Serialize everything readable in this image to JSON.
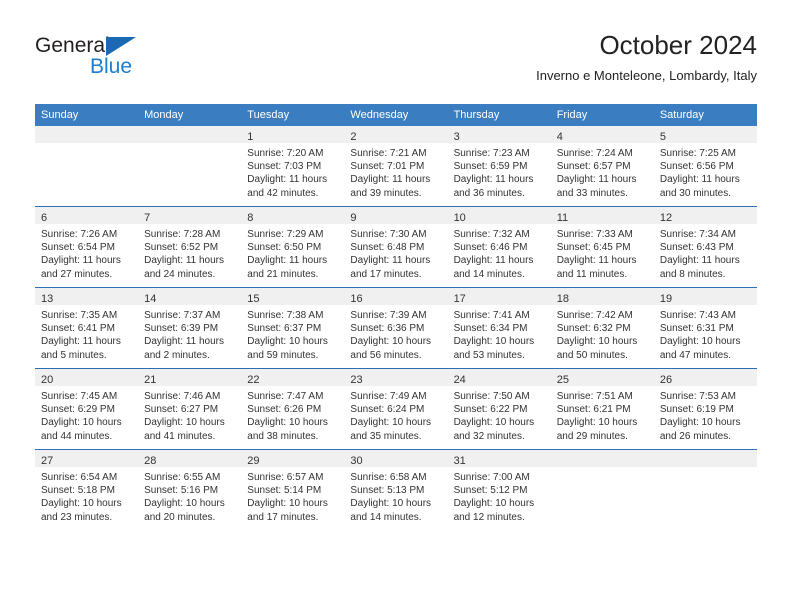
{
  "brand": {
    "name_top": "General",
    "name_bottom": "Blue",
    "accent_color": "#1b7fd1",
    "triangle_color": "#1b69b2"
  },
  "header": {
    "title": "October 2024",
    "subtitle": "Inverno e Monteleone, Lombardy, Italy"
  },
  "calendar": {
    "header_bg": "#3a7ec1",
    "row_border_color": "#2a6eb5",
    "daynum_band_bg": "#f0f0f0",
    "weekday_headers": [
      "Sunday",
      "Monday",
      "Tuesday",
      "Wednesday",
      "Thursday",
      "Friday",
      "Saturday"
    ],
    "weeks": [
      [
        {
          "day": "",
          "sunrise": "",
          "sunset": "",
          "daylight": ""
        },
        {
          "day": "",
          "sunrise": "",
          "sunset": "",
          "daylight": ""
        },
        {
          "day": "1",
          "sunrise": "Sunrise: 7:20 AM",
          "sunset": "Sunset: 7:03 PM",
          "daylight": "Daylight: 11 hours and 42 minutes."
        },
        {
          "day": "2",
          "sunrise": "Sunrise: 7:21 AM",
          "sunset": "Sunset: 7:01 PM",
          "daylight": "Daylight: 11 hours and 39 minutes."
        },
        {
          "day": "3",
          "sunrise": "Sunrise: 7:23 AM",
          "sunset": "Sunset: 6:59 PM",
          "daylight": "Daylight: 11 hours and 36 minutes."
        },
        {
          "day": "4",
          "sunrise": "Sunrise: 7:24 AM",
          "sunset": "Sunset: 6:57 PM",
          "daylight": "Daylight: 11 hours and 33 minutes."
        },
        {
          "day": "5",
          "sunrise": "Sunrise: 7:25 AM",
          "sunset": "Sunset: 6:56 PM",
          "daylight": "Daylight: 11 hours and 30 minutes."
        }
      ],
      [
        {
          "day": "6",
          "sunrise": "Sunrise: 7:26 AM",
          "sunset": "Sunset: 6:54 PM",
          "daylight": "Daylight: 11 hours and 27 minutes."
        },
        {
          "day": "7",
          "sunrise": "Sunrise: 7:28 AM",
          "sunset": "Sunset: 6:52 PM",
          "daylight": "Daylight: 11 hours and 24 minutes."
        },
        {
          "day": "8",
          "sunrise": "Sunrise: 7:29 AM",
          "sunset": "Sunset: 6:50 PM",
          "daylight": "Daylight: 11 hours and 21 minutes."
        },
        {
          "day": "9",
          "sunrise": "Sunrise: 7:30 AM",
          "sunset": "Sunset: 6:48 PM",
          "daylight": "Daylight: 11 hours and 17 minutes."
        },
        {
          "day": "10",
          "sunrise": "Sunrise: 7:32 AM",
          "sunset": "Sunset: 6:46 PM",
          "daylight": "Daylight: 11 hours and 14 minutes."
        },
        {
          "day": "11",
          "sunrise": "Sunrise: 7:33 AM",
          "sunset": "Sunset: 6:45 PM",
          "daylight": "Daylight: 11 hours and 11 minutes."
        },
        {
          "day": "12",
          "sunrise": "Sunrise: 7:34 AM",
          "sunset": "Sunset: 6:43 PM",
          "daylight": "Daylight: 11 hours and 8 minutes."
        }
      ],
      [
        {
          "day": "13",
          "sunrise": "Sunrise: 7:35 AM",
          "sunset": "Sunset: 6:41 PM",
          "daylight": "Daylight: 11 hours and 5 minutes."
        },
        {
          "day": "14",
          "sunrise": "Sunrise: 7:37 AM",
          "sunset": "Sunset: 6:39 PM",
          "daylight": "Daylight: 11 hours and 2 minutes."
        },
        {
          "day": "15",
          "sunrise": "Sunrise: 7:38 AM",
          "sunset": "Sunset: 6:37 PM",
          "daylight": "Daylight: 10 hours and 59 minutes."
        },
        {
          "day": "16",
          "sunrise": "Sunrise: 7:39 AM",
          "sunset": "Sunset: 6:36 PM",
          "daylight": "Daylight: 10 hours and 56 minutes."
        },
        {
          "day": "17",
          "sunrise": "Sunrise: 7:41 AM",
          "sunset": "Sunset: 6:34 PM",
          "daylight": "Daylight: 10 hours and 53 minutes."
        },
        {
          "day": "18",
          "sunrise": "Sunrise: 7:42 AM",
          "sunset": "Sunset: 6:32 PM",
          "daylight": "Daylight: 10 hours and 50 minutes."
        },
        {
          "day": "19",
          "sunrise": "Sunrise: 7:43 AM",
          "sunset": "Sunset: 6:31 PM",
          "daylight": "Daylight: 10 hours and 47 minutes."
        }
      ],
      [
        {
          "day": "20",
          "sunrise": "Sunrise: 7:45 AM",
          "sunset": "Sunset: 6:29 PM",
          "daylight": "Daylight: 10 hours and 44 minutes."
        },
        {
          "day": "21",
          "sunrise": "Sunrise: 7:46 AM",
          "sunset": "Sunset: 6:27 PM",
          "daylight": "Daylight: 10 hours and 41 minutes."
        },
        {
          "day": "22",
          "sunrise": "Sunrise: 7:47 AM",
          "sunset": "Sunset: 6:26 PM",
          "daylight": "Daylight: 10 hours and 38 minutes."
        },
        {
          "day": "23",
          "sunrise": "Sunrise: 7:49 AM",
          "sunset": "Sunset: 6:24 PM",
          "daylight": "Daylight: 10 hours and 35 minutes."
        },
        {
          "day": "24",
          "sunrise": "Sunrise: 7:50 AM",
          "sunset": "Sunset: 6:22 PM",
          "daylight": "Daylight: 10 hours and 32 minutes."
        },
        {
          "day": "25",
          "sunrise": "Sunrise: 7:51 AM",
          "sunset": "Sunset: 6:21 PM",
          "daylight": "Daylight: 10 hours and 29 minutes."
        },
        {
          "day": "26",
          "sunrise": "Sunrise: 7:53 AM",
          "sunset": "Sunset: 6:19 PM",
          "daylight": "Daylight: 10 hours and 26 minutes."
        }
      ],
      [
        {
          "day": "27",
          "sunrise": "Sunrise: 6:54 AM",
          "sunset": "Sunset: 5:18 PM",
          "daylight": "Daylight: 10 hours and 23 minutes."
        },
        {
          "day": "28",
          "sunrise": "Sunrise: 6:55 AM",
          "sunset": "Sunset: 5:16 PM",
          "daylight": "Daylight: 10 hours and 20 minutes."
        },
        {
          "day": "29",
          "sunrise": "Sunrise: 6:57 AM",
          "sunset": "Sunset: 5:14 PM",
          "daylight": "Daylight: 10 hours and 17 minutes."
        },
        {
          "day": "30",
          "sunrise": "Sunrise: 6:58 AM",
          "sunset": "Sunset: 5:13 PM",
          "daylight": "Daylight: 10 hours and 14 minutes."
        },
        {
          "day": "31",
          "sunrise": "Sunrise: 7:00 AM",
          "sunset": "Sunset: 5:12 PM",
          "daylight": "Daylight: 10 hours and 12 minutes."
        },
        {
          "day": "",
          "sunrise": "",
          "sunset": "",
          "daylight": ""
        },
        {
          "day": "",
          "sunrise": "",
          "sunset": "",
          "daylight": ""
        }
      ]
    ]
  }
}
